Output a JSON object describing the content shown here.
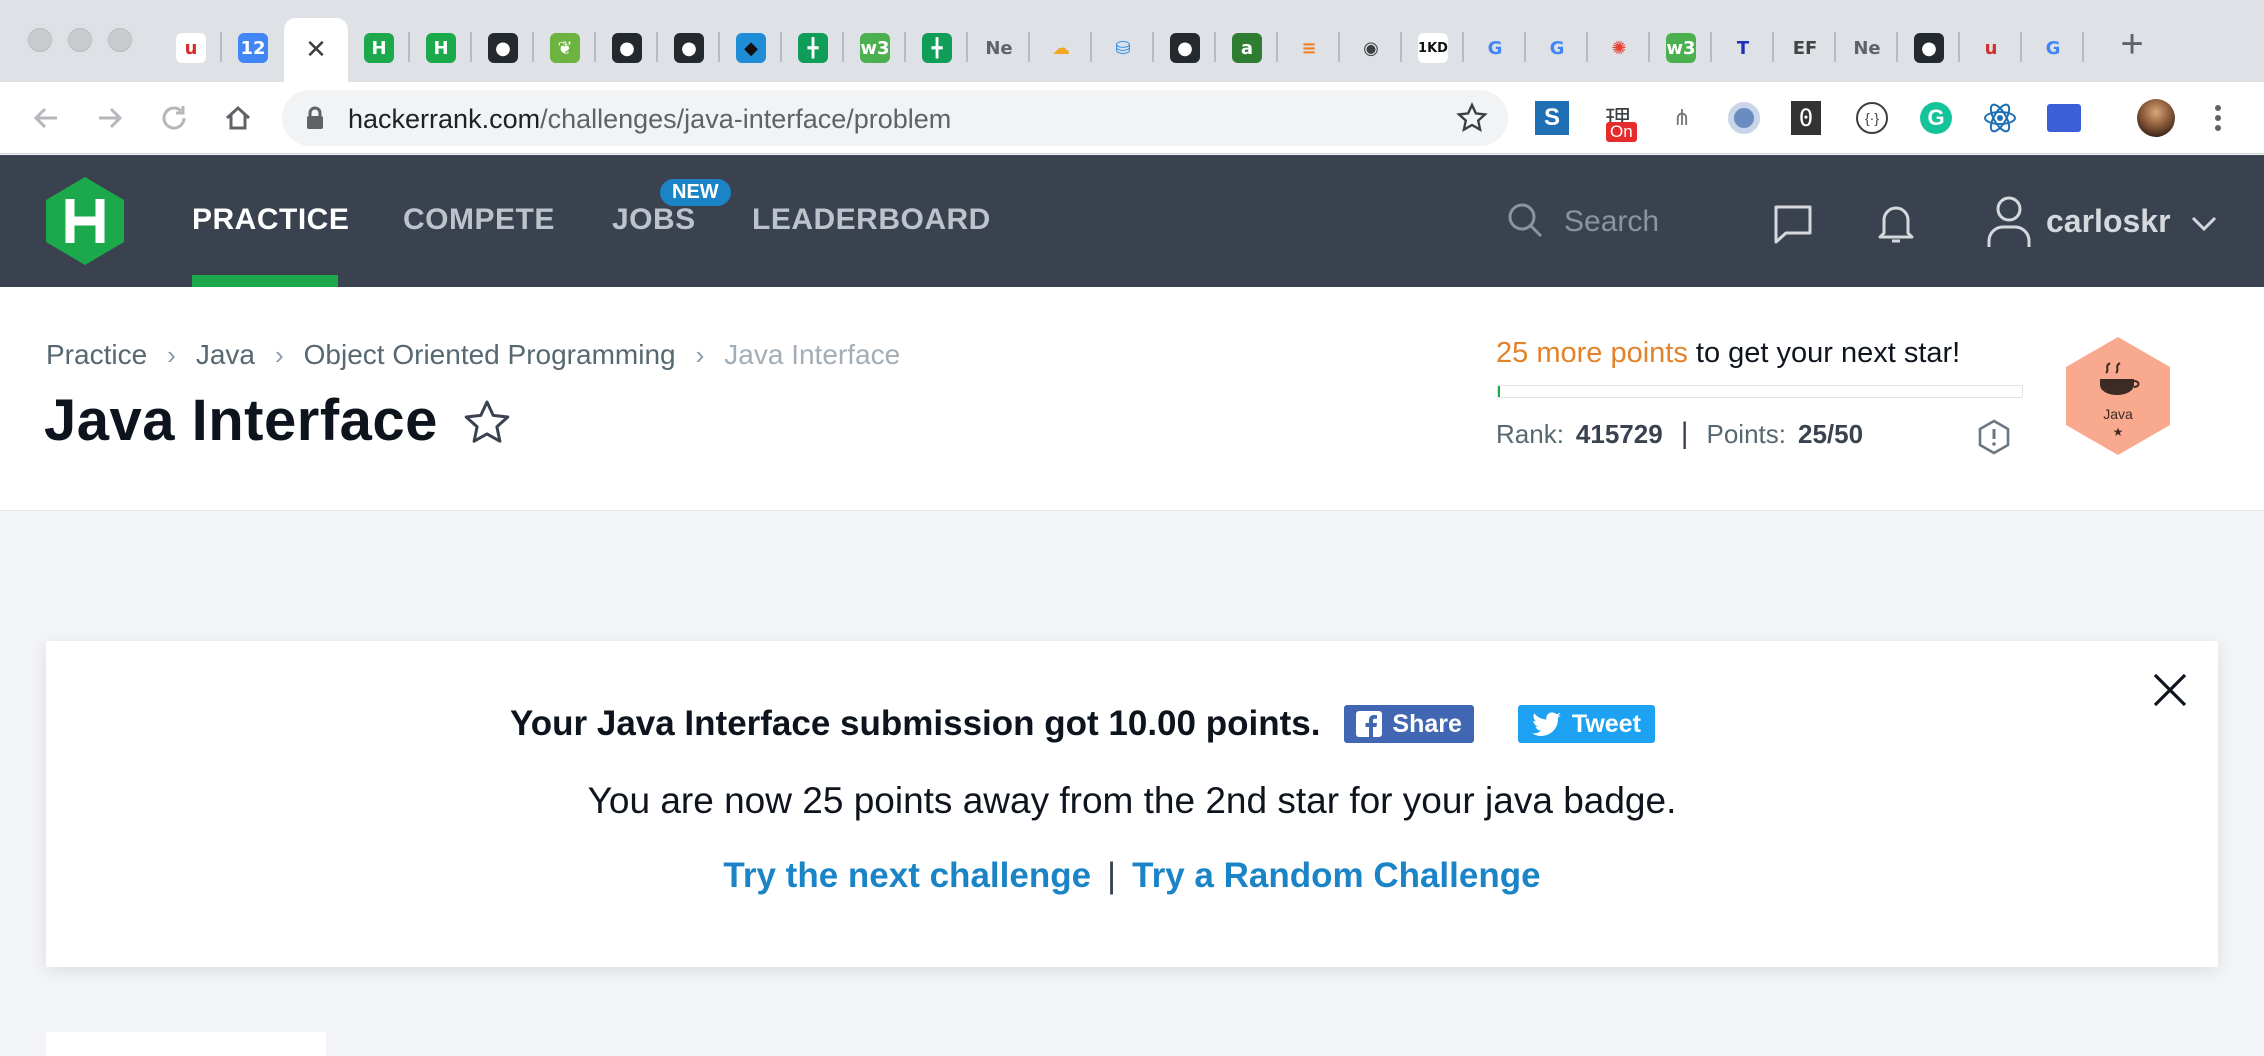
{
  "browser": {
    "tabs": [
      {
        "icon": "udemy-icon",
        "glyph": "u",
        "bg": "#ffffff",
        "fg": "#d32f2f"
      },
      {
        "icon": "calendar-icon",
        "glyph": "12",
        "bg": "#4285f4",
        "fg": "#ffffff"
      },
      {
        "icon": "close-icon",
        "glyph": "✕",
        "bg": "#ffffff",
        "fg": "#3c4043",
        "active": true
      },
      {
        "icon": "hackerrank-icon",
        "glyph": "H",
        "bg": "#1ba94c",
        "fg": "#ffffff"
      },
      {
        "icon": "hackerrank-icon",
        "glyph": "H",
        "bg": "#1ba94c",
        "fg": "#ffffff"
      },
      {
        "icon": "github-icon",
        "glyph": "●",
        "bg": "#24292e",
        "fg": "#ffffff"
      },
      {
        "icon": "spring-icon",
        "glyph": "❦",
        "bg": "#6db33f",
        "fg": "#ffffff"
      },
      {
        "icon": "github-icon",
        "glyph": "●",
        "bg": "#24292e",
        "fg": "#ffffff"
      },
      {
        "icon": "github-icon",
        "glyph": "●",
        "bg": "#24292e",
        "fg": "#ffffff"
      },
      {
        "icon": "bird-icon",
        "glyph": "◆",
        "bg": "#1f8dd6",
        "fg": "#111111"
      },
      {
        "icon": "sheets-icon",
        "glyph": "╋",
        "bg": "#0f9d58",
        "fg": "#ffffff"
      },
      {
        "icon": "w3schools-icon",
        "glyph": "w3",
        "bg": "#4caf50",
        "fg": "#ffffff"
      },
      {
        "icon": "sheets-icon",
        "glyph": "╋",
        "bg": "#0f9d58",
        "fg": "#ffffff"
      },
      {
        "icon": "text-icon",
        "glyph": "Ne",
        "bg": "#dee1e6",
        "fg": "#5f6368"
      },
      {
        "icon": "cloud-icon",
        "glyph": "☁",
        "bg": "#dee1e6",
        "fg": "#f4a623"
      },
      {
        "icon": "database-icon",
        "glyph": "⛁",
        "bg": "#dee1e6",
        "fg": "#1e88e5"
      },
      {
        "icon": "github-icon",
        "glyph": "●",
        "bg": "#24292e",
        "fg": "#ffffff"
      },
      {
        "icon": "atom-icon",
        "glyph": "a",
        "bg": "#2e7d32",
        "fg": "#ffffff"
      },
      {
        "icon": "stackoverflow-icon",
        "glyph": "≡",
        "bg": "#dee1e6",
        "fg": "#f48024"
      },
      {
        "icon": "globe-icon",
        "glyph": "◉",
        "bg": "#dee1e6",
        "fg": "#3c4043"
      },
      {
        "icon": "1kd-icon",
        "glyph": "1KD",
        "bg": "#ffffff",
        "fg": "#111111"
      },
      {
        "icon": "google-icon",
        "glyph": "G",
        "bg": "#dee1e6",
        "fg": "#4285f4"
      },
      {
        "icon": "google-icon",
        "glyph": "G",
        "bg": "#dee1e6",
        "fg": "#4285f4"
      },
      {
        "icon": "color-wheel-icon",
        "glyph": "✺",
        "bg": "#dee1e6",
        "fg": "#e94235"
      },
      {
        "icon": "w3schools-icon",
        "glyph": "w3",
        "bg": "#4caf50",
        "fg": "#ffffff"
      },
      {
        "icon": "t-icon",
        "glyph": "T",
        "bg": "#dee1e6",
        "fg": "#1a33b8"
      },
      {
        "icon": "ef-icon",
        "glyph": "EF",
        "bg": "#dee1e6",
        "fg": "#444444"
      },
      {
        "icon": "text-icon",
        "glyph": "Ne",
        "bg": "#dee1e6",
        "fg": "#5f6368"
      },
      {
        "icon": "github-icon",
        "glyph": "●",
        "bg": "#24292e",
        "fg": "#ffffff"
      },
      {
        "icon": "udemy-icon",
        "glyph": "u",
        "bg": "#dee1e6",
        "fg": "#d32f2f"
      },
      {
        "icon": "google-icon",
        "glyph": "G",
        "bg": "#dee1e6",
        "fg": "#4285f4"
      }
    ],
    "url_host": "hackerrank.com",
    "url_path": "/challenges/java-interface/problem",
    "extension_badge": "On"
  },
  "nav": {
    "items": [
      "PRACTICE",
      "COMPETE",
      "JOBS",
      "LEADERBOARD"
    ],
    "new_badge": "NEW",
    "search_placeholder": "Search",
    "username": "carloskr"
  },
  "header": {
    "breadcrumbs": [
      "Practice",
      "Java",
      "Object Oriented Programming",
      "Java Interface"
    ],
    "title": "Java Interface",
    "next_star_highlight": "25 more points",
    "next_star_rest": " to get your next star!",
    "progress_fraction": 0.004,
    "rank_label": "Rank:",
    "rank_value": "415729",
    "points_label": "Points:",
    "points_value": "25/50",
    "badge_label": "Java",
    "badge_star": "★"
  },
  "modal": {
    "submission_text": "Your Java Interface submission got 10.00 points.",
    "share_label": "Share",
    "tweet_label": "Tweet",
    "away_text": "You are now 25 points away from the 2nd star for your java badge.",
    "next_challenge": "Try the next challenge",
    "separator": "|",
    "random_challenge": "Try a Random Challenge"
  },
  "colors": {
    "nav_bg": "#39424e",
    "accent_green": "#1ba94c",
    "link_blue": "#1a84c7",
    "highlight_orange": "#e2832c",
    "badge_bg": "#f9a98e"
  }
}
